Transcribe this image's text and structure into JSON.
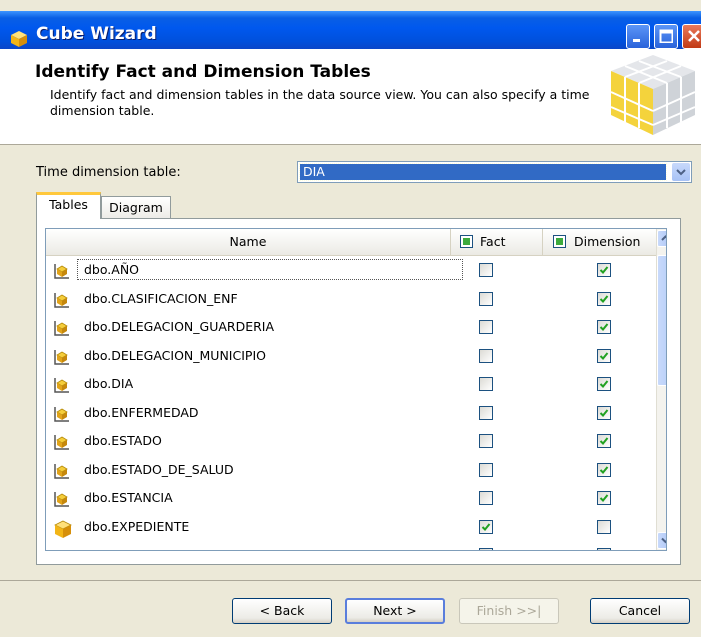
{
  "window": {
    "title": "Cube Wizard",
    "accent": "#0058EE"
  },
  "header": {
    "title": "Identify Fact and Dimension Tables",
    "description": "Identify fact and dimension tables in the data source view. You can also specify a time dimension table."
  },
  "time_dimension": {
    "label": "Time dimension table:",
    "value": "DIA"
  },
  "tabs": [
    {
      "label": "Tables",
      "active": true
    },
    {
      "label": "Diagram",
      "active": false
    }
  ],
  "grid": {
    "columns": {
      "name": "Name",
      "fact": "Fact",
      "dimension": "Dimension"
    },
    "rows": [
      {
        "name": "dbo.AÑO",
        "icon": "dimension-table-icon",
        "fact": false,
        "dimension": true
      },
      {
        "name": "dbo.CLASIFICACION_ENF",
        "icon": "dimension-table-icon",
        "fact": false,
        "dimension": true
      },
      {
        "name": "dbo.DELEGACION_GUARDERIA",
        "icon": "dimension-table-icon",
        "fact": false,
        "dimension": true
      },
      {
        "name": "dbo.DELEGACION_MUNICIPIO",
        "icon": "dimension-table-icon",
        "fact": false,
        "dimension": true
      },
      {
        "name": "dbo.DIA",
        "icon": "dimension-table-icon",
        "fact": false,
        "dimension": true
      },
      {
        "name": "dbo.ENFERMEDAD",
        "icon": "dimension-table-icon",
        "fact": false,
        "dimension": true
      },
      {
        "name": "dbo.ESTADO",
        "icon": "dimension-table-icon",
        "fact": false,
        "dimension": true
      },
      {
        "name": "dbo.ESTADO_DE_SALUD",
        "icon": "dimension-table-icon",
        "fact": false,
        "dimension": true
      },
      {
        "name": "dbo.ESTANCIA",
        "icon": "dimension-table-icon",
        "fact": false,
        "dimension": true
      },
      {
        "name": "dbo.EXPEDIENTE",
        "icon": "fact-table-icon",
        "fact": true,
        "dimension": false
      }
    ]
  },
  "buttons": {
    "back": "< Back",
    "next": "Next >",
    "finish": "Finish >>|",
    "cancel": "Cancel"
  }
}
